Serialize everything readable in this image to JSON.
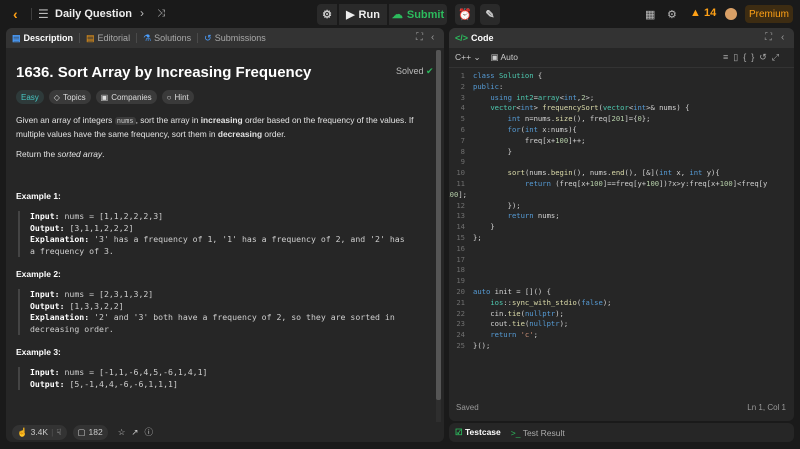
{
  "topbar": {
    "title": "Daily Question",
    "run": "Run",
    "submit": "Submit",
    "streak": "14",
    "premium": "Premium"
  },
  "left_tabs": [
    "Description",
    "Editorial",
    "Solutions",
    "Submissions"
  ],
  "problem": {
    "title": "1636. Sort Array by Increasing Frequency",
    "status": "Solved",
    "tags": [
      "Easy",
      "Topics",
      "Companies",
      "Hint"
    ],
    "desc_1a": "Given an array of integers ",
    "desc_code": "nums",
    "desc_1b": ", sort the array in ",
    "desc_bold1": "increasing",
    "desc_1c": " order based on the frequency of the values. If multiple values have the same frequency, sort them in ",
    "desc_bold2": "decreasing",
    "desc_1d": " order.",
    "desc_2a": "Return the ",
    "desc_2i": "sorted array",
    "desc_2b": ".",
    "examples": [
      {
        "title": "Example 1:",
        "input_label": "Input:",
        "input": " nums = [1,1,2,2,2,3]",
        "output_label": "Output:",
        "output": " [3,1,1,2,2,2]",
        "expl_label": "Explanation:",
        "expl": " '3' has a frequency of 1, '1' has a frequency of 2, and '2' has a frequency of 3."
      },
      {
        "title": "Example 2:",
        "input_label": "Input:",
        "input": " nums = [2,3,1,3,2]",
        "output_label": "Output:",
        "output": " [1,3,3,2,2]",
        "expl_label": "Explanation:",
        "expl": " '2' and '3' both have a frequency of 2, so they are sorted in decreasing order."
      },
      {
        "title": "Example 3:",
        "input_label": "Input:",
        "input": " nums = [-1,1,-6,4,5,-6,1,4,1]",
        "output_label": "Output:",
        "output": " [5,-1,4,4,-6,-6,1,1,1]"
      }
    ]
  },
  "footer": {
    "likes": "3.4K",
    "comments": "182"
  },
  "code_panel": {
    "title": "Code",
    "language": "C++",
    "mode": "Auto",
    "status": "Saved",
    "cursor": "Ln 1, Col 1"
  },
  "bottom": {
    "testcase": "Testcase",
    "test_result": "Test Result"
  }
}
